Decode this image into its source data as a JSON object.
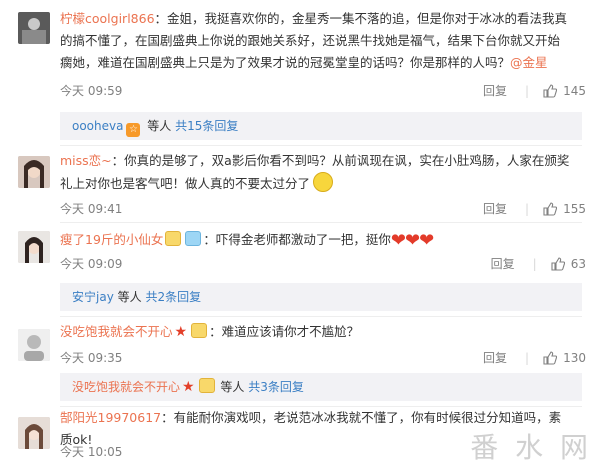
{
  "comments": [
    {
      "user": "柠檬coolgirl866",
      "text": "：金姐，我挺喜欢你的，金星秀一集不落的追，但是你对于冰冰的看法我真的搞不懂了，在国剧盛典上你说的跟她关系好，还说黑牛找她是福气，结果下台你就又开始瘸她，难道在国剧盛典上只是为了效果才说的冠冕堂皇的话吗？你是那样的人吗？",
      "mention": "@金星",
      "time": "今天 09:59",
      "reply": "回复",
      "likes": "145"
    },
    {
      "user": "miss恋~",
      "text": "：你真的是够了，双a影后你看不到吗？从前讽现在讽，实在小肚鸡肠，人家在颁奖礼上对你也是客气吧！做人真的不要太过分了",
      "time": "今天 09:41",
      "reply": "回复",
      "likes": "155"
    },
    {
      "user": "瘦了19斤的小仙女",
      "text": "：吓得金老师都激动了一把，挺你",
      "time": "今天 09:09",
      "reply": "回复",
      "likes": "63"
    },
    {
      "user": "没吃饱我就会不开心",
      "text": "：难道应该请你才不尴尬？",
      "time": "今天 09:35",
      "reply": "回复",
      "likes": "130"
    },
    {
      "user": "郜阳光19970617",
      "text": "：有能耐你演戏呗，老说范冰冰我就不懂了，你有时候很过分知道吗，素质ok!",
      "time": "今天 10:05",
      "reply": "回复",
      "likes": ""
    }
  ],
  "more": [
    {
      "user": "oooheva",
      "badge": "☆",
      "suffix": "等人",
      "count": "共15条回复"
    },
    {
      "user": "安宁jay",
      "suffix": "等人",
      "count": "共2条回复"
    },
    {
      "user": "没吃饱我就会不开心",
      "suffix": "等人",
      "count": "共3条回复"
    }
  ],
  "watermark": "番 水 网",
  "icons": {
    "like": "thumbs-up-icon",
    "smile": "smile-emoji-icon",
    "hearts": "heart-emoji-icon",
    "star": "star-icon",
    "vip": "vip-badge-icon"
  },
  "colors": {
    "username": "#eb7350",
    "link_blue": "#3b7fc4",
    "meta_gray": "#808080",
    "reply_box": "#f2f2f5"
  }
}
